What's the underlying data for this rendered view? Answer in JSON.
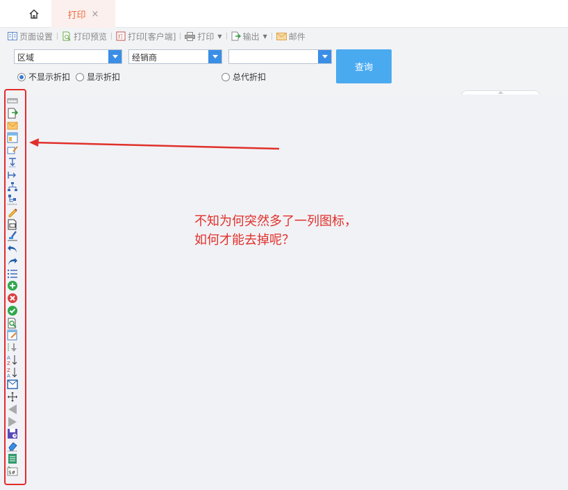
{
  "tabs": {
    "home_icon": "home-icon",
    "active_label": "打印",
    "close_glyph": "×"
  },
  "toolbar": {
    "page_setup": "页面设置",
    "print_preview": "打印预览",
    "print_client": "打印[客户端]",
    "print": "打印",
    "export": "输出",
    "mail": "邮件"
  },
  "filters": {
    "region": "区域",
    "dealer": "经销商",
    "third": "",
    "query_button": "查询"
  },
  "radios": {
    "hide_discount": "不显示折扣",
    "show_discount": "显示折扣",
    "total_discount": "总代折扣"
  },
  "annotation": {
    "line1": "不知为何突然多了一列图标，",
    "line2": "如何才能去掉呢？"
  },
  "colors": {
    "accent_orange": "#ef6a3c",
    "query_blue": "#4aaaf0",
    "annotation_red": "#e0302a"
  }
}
